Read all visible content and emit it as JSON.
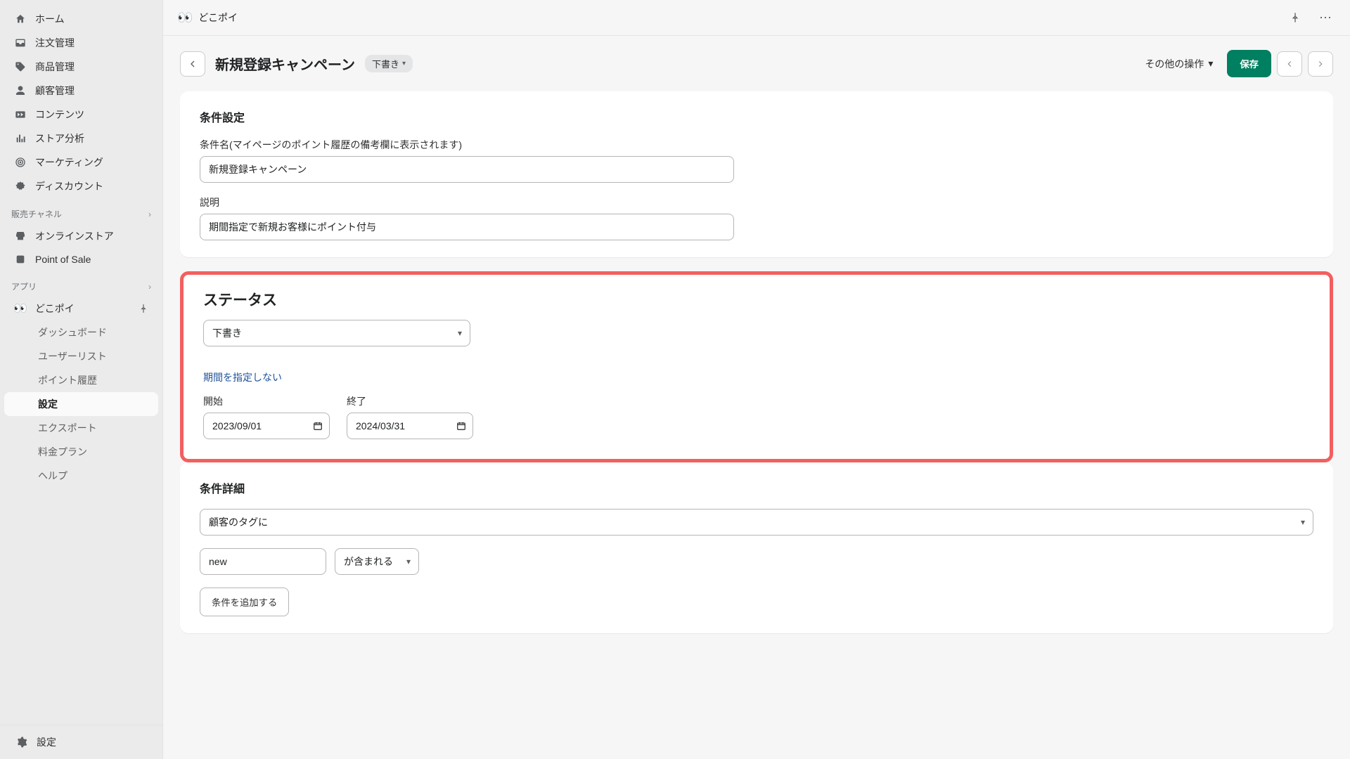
{
  "sidebar": {
    "items": [
      {
        "icon": "home",
        "label": "ホーム"
      },
      {
        "icon": "inbox",
        "label": "注文管理"
      },
      {
        "icon": "tag",
        "label": "商品管理"
      },
      {
        "icon": "person",
        "label": "顧客管理"
      },
      {
        "icon": "camera",
        "label": "コンテンツ"
      },
      {
        "icon": "chart",
        "label": "ストア分析"
      },
      {
        "icon": "target",
        "label": "マーケティング"
      },
      {
        "icon": "discount",
        "label": "ディスカウント"
      }
    ],
    "channels_header": "販売チャネル",
    "channels": [
      {
        "icon": "store",
        "label": "オンラインストア"
      },
      {
        "icon": "pos",
        "label": "Point of Sale"
      }
    ],
    "apps_header": "アプリ",
    "current_app": {
      "emoji": "👀",
      "label": "どこポイ"
    },
    "subnav": [
      "ダッシュボード",
      "ユーザーリスト",
      "ポイント履歴",
      "設定",
      "エクスポート",
      "料金プラン",
      "ヘルプ"
    ],
    "subnav_active_index": 3,
    "footer_settings": "設定"
  },
  "topbar": {
    "emoji": "👀",
    "app_name": "どこポイ"
  },
  "page": {
    "title": "新規登録キャンペーン",
    "badge": "下書き",
    "other_ops": "その他の操作",
    "save": "保存"
  },
  "card_conditions": {
    "heading": "条件設定",
    "name_label": "条件名(マイページのポイント履歴の備考欄に表示されます)",
    "name_value": "新規登録キャンペーン",
    "desc_label": "説明",
    "desc_value": "期間指定で新規お客様にポイント付与"
  },
  "card_status": {
    "heading": "ステータス",
    "status_value": "下書き",
    "no_period_link": "期間を指定しない",
    "start_label": "開始",
    "start_value": "2023/09/01",
    "end_label": "終了",
    "end_value": "2024/03/31"
  },
  "card_detail": {
    "heading": "条件詳細",
    "target_value": "顧客のタグに",
    "tag_value": "new",
    "match_value": "が含まれる",
    "add_btn": "条件を追加する"
  }
}
